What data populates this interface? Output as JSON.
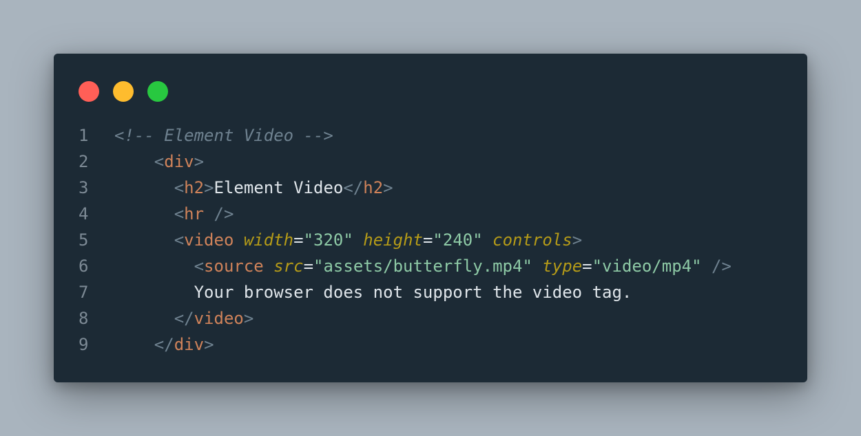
{
  "window": {
    "controls": [
      {
        "name": "close",
        "color": "#ff5f57"
      },
      {
        "name": "minimize",
        "color": "#febc2e"
      },
      {
        "name": "maximize",
        "color": "#28c840"
      }
    ]
  },
  "code": {
    "lines": [
      {
        "number": "1",
        "indent": 0,
        "tokens": [
          {
            "type": "comment",
            "text": "<!-- Element Video -->"
          }
        ]
      },
      {
        "number": "2",
        "indent": 4,
        "tokens": [
          {
            "type": "punct",
            "text": "<"
          },
          {
            "type": "tag",
            "text": "div"
          },
          {
            "type": "punct",
            "text": ">"
          }
        ]
      },
      {
        "number": "3",
        "indent": 6,
        "tokens": [
          {
            "type": "punct",
            "text": "<"
          },
          {
            "type": "tag",
            "text": "h2"
          },
          {
            "type": "punct",
            "text": ">"
          },
          {
            "type": "text",
            "text": "Element Video"
          },
          {
            "type": "punct",
            "text": "</"
          },
          {
            "type": "tag",
            "text": "h2"
          },
          {
            "type": "punct",
            "text": ">"
          }
        ]
      },
      {
        "number": "4",
        "indent": 6,
        "tokens": [
          {
            "type": "punct",
            "text": "<"
          },
          {
            "type": "tag",
            "text": "hr"
          },
          {
            "type": "punct",
            "text": " />"
          }
        ]
      },
      {
        "number": "5",
        "indent": 6,
        "tokens": [
          {
            "type": "punct",
            "text": "<"
          },
          {
            "type": "tag",
            "text": "video"
          },
          {
            "type": "text",
            "text": " "
          },
          {
            "type": "attr",
            "text": "width"
          },
          {
            "type": "eq",
            "text": "="
          },
          {
            "type": "str",
            "text": "\"320\""
          },
          {
            "type": "text",
            "text": " "
          },
          {
            "type": "attr",
            "text": "height"
          },
          {
            "type": "eq",
            "text": "="
          },
          {
            "type": "str",
            "text": "\"240\""
          },
          {
            "type": "text",
            "text": " "
          },
          {
            "type": "attr",
            "text": "controls"
          },
          {
            "type": "punct",
            "text": ">"
          }
        ]
      },
      {
        "number": "6",
        "indent": 8,
        "tokens": [
          {
            "type": "punct",
            "text": "<"
          },
          {
            "type": "tag",
            "text": "source"
          },
          {
            "type": "text",
            "text": " "
          },
          {
            "type": "attr",
            "text": "src"
          },
          {
            "type": "eq",
            "text": "="
          },
          {
            "type": "str",
            "text": "\"assets/butterfly.mp4\""
          },
          {
            "type": "text",
            "text": " "
          },
          {
            "type": "attr",
            "text": "type"
          },
          {
            "type": "eq",
            "text": "="
          },
          {
            "type": "str",
            "text": "\"video/mp4\""
          },
          {
            "type": "punct",
            "text": " />"
          }
        ]
      },
      {
        "number": "7",
        "indent": 8,
        "tokens": [
          {
            "type": "text",
            "text": "Your browser does not support the video tag."
          }
        ]
      },
      {
        "number": "8",
        "indent": 6,
        "tokens": [
          {
            "type": "punct",
            "text": "</"
          },
          {
            "type": "tag",
            "text": "video"
          },
          {
            "type": "punct",
            "text": ">"
          }
        ]
      },
      {
        "number": "9",
        "indent": 4,
        "tokens": [
          {
            "type": "punct",
            "text": "</"
          },
          {
            "type": "tag",
            "text": "div"
          },
          {
            "type": "punct",
            "text": ">"
          }
        ]
      }
    ]
  }
}
